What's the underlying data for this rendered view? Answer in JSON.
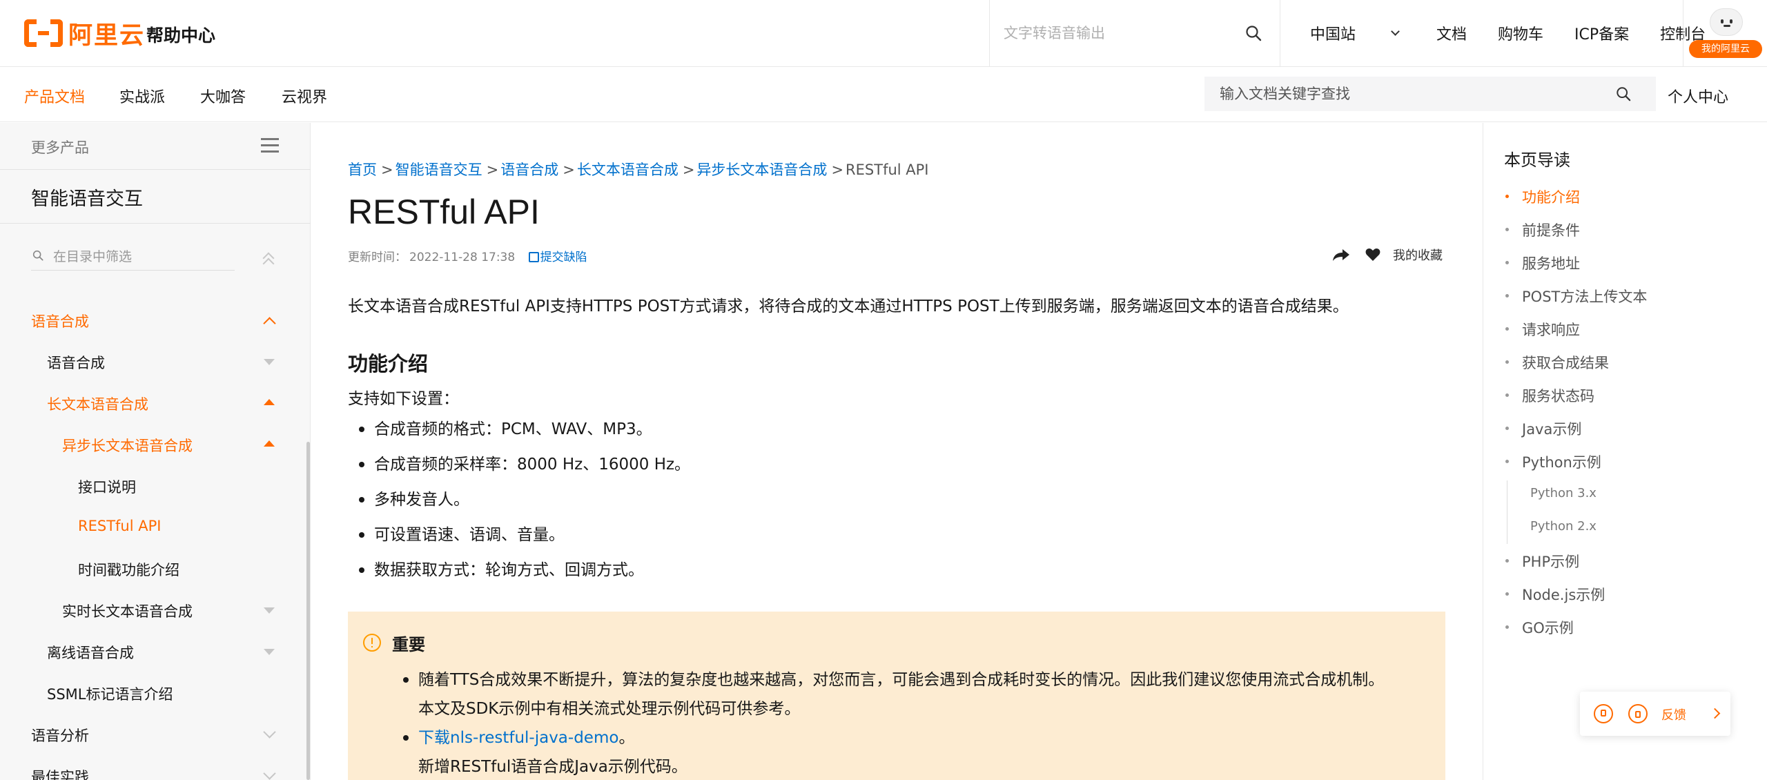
{
  "header": {
    "logo_text": "阿里云",
    "help_center": "帮助中心",
    "search_placeholder": "文字转语音输出",
    "nav": {
      "region": "中国站",
      "docs": "文档",
      "cart": "购物车",
      "icp": "ICP备案",
      "console": "控制台"
    },
    "my_aliyun": "我的阿里云"
  },
  "subnav": {
    "tabs": [
      "产品文档",
      "实战派",
      "大咖答",
      "云视界"
    ],
    "active_tab": "产品文档",
    "doc_search_placeholder": "输入文档关键字查找",
    "personal_center": "个人中心"
  },
  "sidebar": {
    "more_products": "更多产品",
    "product_title": "智能语音交互",
    "filter_placeholder": "在目录中筛选",
    "tree": [
      {
        "label": "语音合成",
        "active": true
      },
      {
        "label": "语音合成",
        "active": false
      },
      {
        "label": "长文本语音合成",
        "active": true
      },
      {
        "label": "异步长文本语音合成",
        "active": true
      },
      {
        "label": "接口说明",
        "active": false
      },
      {
        "label": "RESTful API",
        "active": true
      },
      {
        "label": "时间戳功能介绍",
        "active": false
      },
      {
        "label": "实时长文本语音合成",
        "active": false
      },
      {
        "label": "离线语音合成",
        "active": false
      },
      {
        "label": "SSML标记语言介绍",
        "active": false
      },
      {
        "label": "语音分析",
        "active": false
      },
      {
        "label": "最佳实践",
        "active": false
      }
    ]
  },
  "main": {
    "breadcrumb": [
      "首页",
      "智能语音交互",
      "语音合成",
      "长文本语音合成",
      "异步长文本语音合成",
      "RESTful API"
    ],
    "breadcrumb_sep": ">",
    "title": "RESTful API",
    "updated_label": "更新时间：",
    "updated_value": "2022-11-28 17:38",
    "report_label": "提交缺陷",
    "favorite_label": "我的收藏",
    "intro": "长文本语音合成RESTful API支持HTTPS POST方式请求，将待合成的文本通过HTTPS POST上传到服务端，服务端返回文本的语音合成结果。",
    "section_title": "功能介绍",
    "support_text": "支持如下设置：",
    "features": [
      "合成音频的格式：PCM、WAV、MP3。",
      "合成音频的采样率：8000 Hz、16000 Hz。",
      "多种发音人。",
      "可设置语速、语调、音量。",
      "数据获取方式：轮询方式、回调方式。"
    ],
    "notice": {
      "title": "重要",
      "line1": "随着TTS合成效果不断提升，算法的复杂度也越来越高，对您而言，可能会遇到合成耗时变长的情况。因此我们建议您使用流式合成机制。",
      "line2": "本文及SDK示例中有相关流式处理示例代码可供参考。",
      "link": "下载nls-restful-java-demo",
      "link_suffix": "。",
      "line3": "新增RESTful语音合成Java示例代码。"
    }
  },
  "toc": {
    "title": "本页导读",
    "items": [
      "功能介绍",
      "前提条件",
      "服务地址",
      "POST方法上传文本",
      "请求响应",
      "获取合成结果",
      "服务状态码",
      "Java示例",
      "Python示例"
    ],
    "sub_items": [
      "Python 3.x",
      "Python 2.x"
    ],
    "items_after": [
      "PHP示例",
      "Node.js示例",
      "GO示例"
    ]
  },
  "feedback": {
    "label": "反馈"
  },
  "colors": {
    "brand": "#ff6a00",
    "link": "#0070cc",
    "notice_bg": "#fdecd2"
  }
}
